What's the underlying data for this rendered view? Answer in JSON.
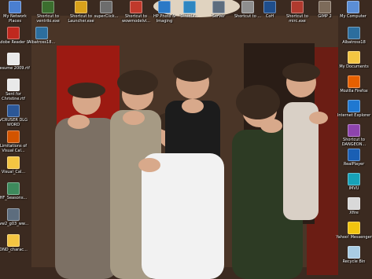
{
  "desktop": {
    "top_icons": [
      {
        "label": "My Network Places",
        "icon": "network-places-icon",
        "color": "#4a7fd1"
      },
      {
        "label": "Shortcut to ventrilo.exe",
        "icon": "ventrilo-icon",
        "color": "#3b6e2e"
      },
      {
        "label": "Shortcut to Launcher.exe",
        "icon": "launcher-icon",
        "color": "#d9a11b"
      },
      {
        "label": "superClick...",
        "icon": "superclick-icon",
        "color": "#6d6d6d"
      },
      {
        "label": "Shortcut to wowmodelvi...",
        "icon": "wowmodelviewer-icon",
        "color": "#c0392b"
      },
      {
        "label": "HP Photo & Imaging",
        "icon": "hp-photo-icon",
        "color": "#2b79c6"
      },
      {
        "label": "DirectX...",
        "icon": "directx-icon",
        "color": "#2e86c1"
      },
      {
        "label": "Server",
        "icon": "server-icon",
        "color": "#5d6d7e"
      },
      {
        "label": "Shortcut to ...",
        "icon": "shortcut-icon",
        "color": "#8e8e8e"
      },
      {
        "label": "CoH",
        "icon": "coh-icon",
        "color": "#1f4e8c"
      },
      {
        "label": "Shortcut to mirc.exe",
        "icon": "mirc-icon",
        "color": "#b03a2e"
      },
      {
        "label": "GIMP 2",
        "icon": "gimp-icon",
        "color": "#7d6b5a"
      },
      {
        "label": "My Computer",
        "icon": "my-computer-icon",
        "color": "#5b8ed6"
      }
    ],
    "left_icons": [
      {
        "label": "Adobe Reader 8",
        "icon": "adobe-reader-icon",
        "color": "#c0281e"
      },
      {
        "label": "Albatross18...",
        "icon": "albatross-icon",
        "color": "#2c6e9e"
      },
      {
        "label": "Resume 2009.rtf",
        "icon": "rtf-document-icon",
        "color": "#e9e9e9"
      },
      {
        "label": "Sent for Christine.rtf",
        "icon": "rtf-document-icon",
        "color": "#e9e9e9"
      },
      {
        "label": "VCRUSER DLG WORD",
        "icon": "word-document-icon",
        "color": "#2b5797"
      },
      {
        "label": "Limitations of Visual Cal...",
        "icon": "document-icon",
        "color": "#d35400"
      },
      {
        "label": "Visual_Cal...",
        "icon": "folder-icon",
        "color": "#f4c542"
      },
      {
        "label": "HF_Seasons...",
        "icon": "image-icon",
        "color": "#3d8a5c"
      },
      {
        "label": "ww2_g03_ww...",
        "icon": "file-icon",
        "color": "#5d6d7e"
      },
      {
        "label": "DND_charac...",
        "icon": "folder-icon",
        "color": "#f4c542"
      }
    ],
    "right_icons": [
      {
        "label": "Albatross18",
        "icon": "albatross-icon",
        "color": "#2c6e9e"
      },
      {
        "label": "My Documents",
        "icon": "my-documents-icon",
        "color": "#f4c542"
      },
      {
        "label": "Mozilla Firefox",
        "icon": "firefox-icon",
        "color": "#e66000"
      },
      {
        "label": "Internet Explorer",
        "icon": "internet-explorer-icon",
        "color": "#1f78d1"
      },
      {
        "label": "Shortcut to DANGEON...",
        "icon": "dungeon-icon",
        "color": "#8e44ad"
      },
      {
        "label": "RealPlayer",
        "icon": "realplayer-icon",
        "color": "#1a5fb4"
      },
      {
        "label": "IMVU",
        "icon": "imvu-icon",
        "color": "#17a2b8"
      },
      {
        "label": "Xfire",
        "icon": "xfire-icon",
        "color": "#d9d9d9"
      },
      {
        "label": "Yahoo! Messenger",
        "icon": "yahoo-messenger-icon",
        "color": "#f1c40f"
      },
      {
        "label": "Recycle Bin",
        "icon": "recycle-bin-icon",
        "color": "#a9cce3"
      }
    ]
  }
}
